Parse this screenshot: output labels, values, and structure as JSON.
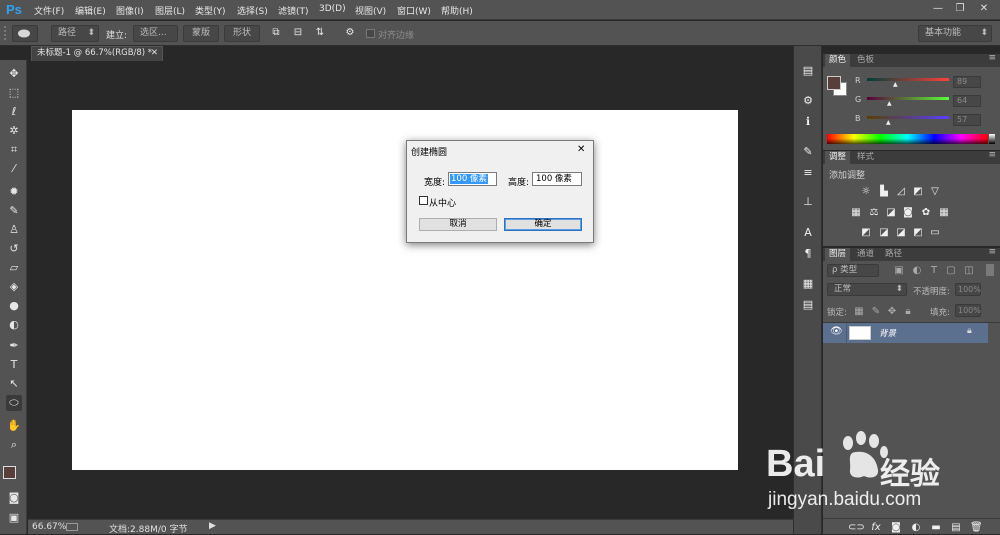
{
  "app": {
    "logo": "Ps"
  },
  "menu": [
    "文件(F)",
    "编辑(E)",
    "图像(I)",
    "图层(L)",
    "类型(Y)",
    "选择(S)",
    "滤镜(T)",
    "3D(D)",
    "视图(V)",
    "窗口(W)",
    "帮助(H)"
  ],
  "window_controls": {
    "minimize": "—",
    "restore": "❐",
    "close": "✕"
  },
  "options_bar": {
    "mode": "路径",
    "make_label": "建立:",
    "selection_btn": "选区...",
    "mask_btn": "蒙版",
    "shape_btn": "形状",
    "align_edges": "对齐边缘",
    "workspace": "基本功能"
  },
  "document": {
    "tab_title": "未标题-1 @ 66.7%(RGB/8) *",
    "zoom": "66.67%",
    "doc_info": "文档:2.88M/0 字节"
  },
  "color_panel": {
    "tabs": [
      "颜色",
      "色板"
    ],
    "channels": [
      {
        "label": "R",
        "value": "89"
      },
      {
        "label": "G",
        "value": "64"
      },
      {
        "label": "B",
        "value": "57"
      }
    ],
    "foreground": "#593f39",
    "background": "#ffffff"
  },
  "adjust_panel": {
    "tabs": [
      "调整",
      "样式"
    ],
    "title": "添加调整"
  },
  "layers_panel": {
    "tabs": [
      "图层",
      "通道",
      "路径"
    ],
    "filter": "ρ 类型",
    "blend_mode": "正常",
    "opacity_label": "不透明度:",
    "opacity_value": "100%",
    "lock_label": "锁定:",
    "fill_label": "填充:",
    "fill_value": "100%",
    "layer_name": "背景"
  },
  "dialog": {
    "title": "创建椭圆",
    "width_label": "宽度:",
    "width_value": "100 像素",
    "height_label": "高度:",
    "height_value": "100 像素",
    "from_center": "从中心",
    "cancel": "取消",
    "ok": "确定",
    "close": "✕"
  },
  "watermark": {
    "brand": "Bai",
    "brand2": "经验",
    "url": "jingyan.baidu.com"
  },
  "colors": {
    "accent": "#2fa3f1",
    "selected_layer": "#5b6f8e"
  }
}
